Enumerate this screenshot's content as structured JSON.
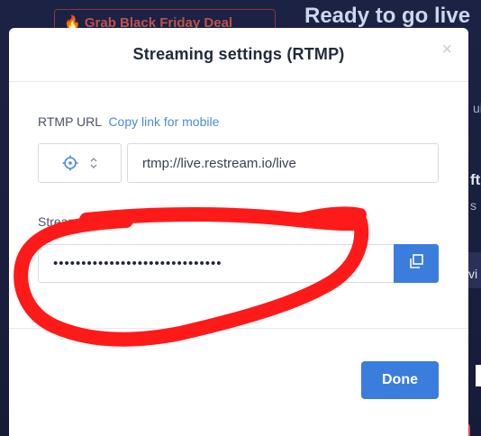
{
  "background": {
    "promo_text": "🔥 Grab Black Friday Deal",
    "heading": "Ready to go live",
    "side_a": "ui",
    "side_b": "ft",
    "side_c": "s",
    "side_d": "vi"
  },
  "modal": {
    "title": "Streaming settings (RTMP)",
    "close_label": "×",
    "rtmp_url_label": "RTMP URL",
    "copy_link_label": "Copy link for mobile",
    "rtmp_url_value": "rtmp://live.restream.io/live",
    "stream_key_label": "Stream key",
    "stream_key_value": "••••••••••••••••••••••••••••••",
    "done_label": "Done"
  },
  "icons": {
    "selector_target": "crosshair-icon",
    "selector_arrows": "chevron-up-down-icon",
    "copy": "copy-icon",
    "close": "close-icon"
  },
  "colors": {
    "accent": "#3b7ddd",
    "link": "#4b8bdb",
    "annotation": "#ff1a1a",
    "background": "#1b2140"
  }
}
